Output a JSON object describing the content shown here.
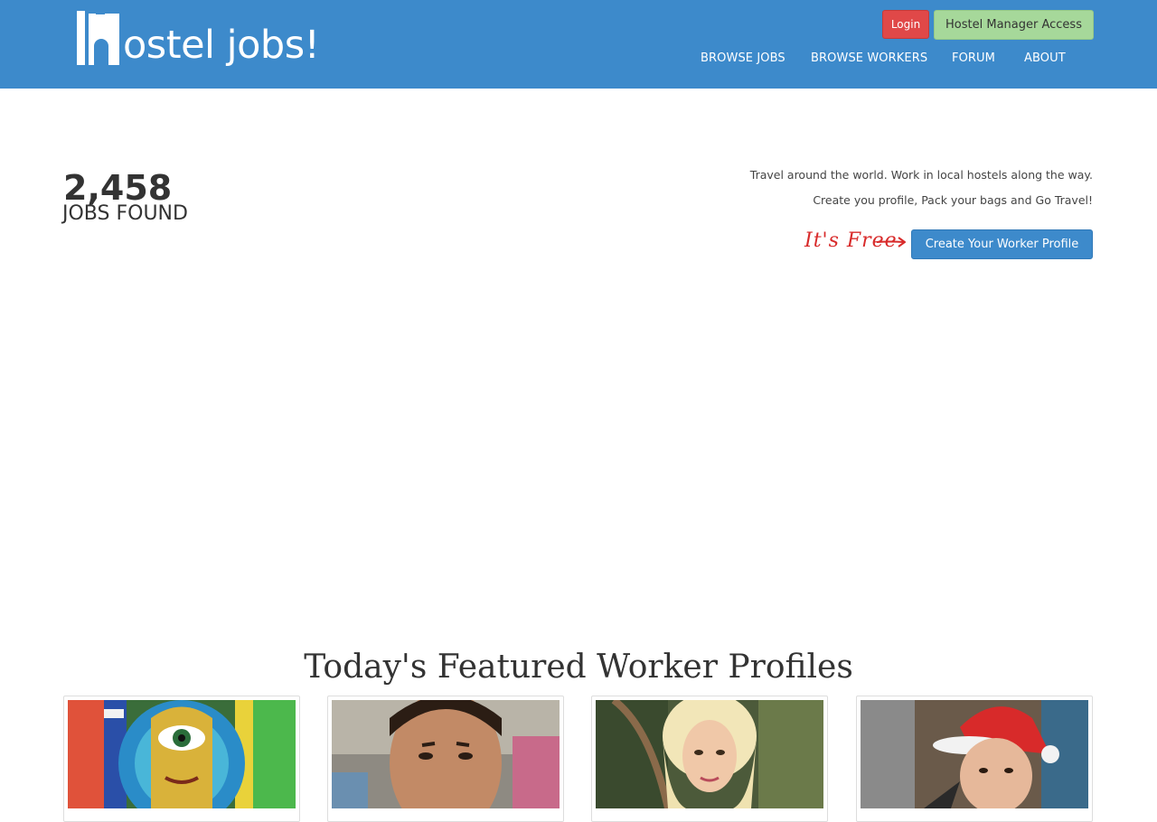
{
  "brand": {
    "logo_text": "ostel jobs!"
  },
  "header": {
    "login_label": "Login",
    "manager_label": "Hostel Manager Access",
    "nav": [
      {
        "label": "BROWSE JOBS"
      },
      {
        "label": "BROWSE WORKERS"
      },
      {
        "label": "FORUM"
      },
      {
        "label": "ABOUT"
      }
    ]
  },
  "hero": {
    "jobs_count": "2,458",
    "jobs_label": "JOBS FOUND",
    "tagline_1": "Travel around the world. Work in local hostels along the way.",
    "tagline_2": "Create you profile, Pack your bags and Go Travel!",
    "free_note": "It's Free",
    "create_profile_label": "Create Your Worker Profile"
  },
  "featured": {
    "title": "Today's Featured Worker Profiles"
  },
  "colors": {
    "header_bg": "#3d8acb",
    "login_bg": "#e04848",
    "manager_bg": "#a6d89a",
    "accent_red": "#d82a2a"
  }
}
